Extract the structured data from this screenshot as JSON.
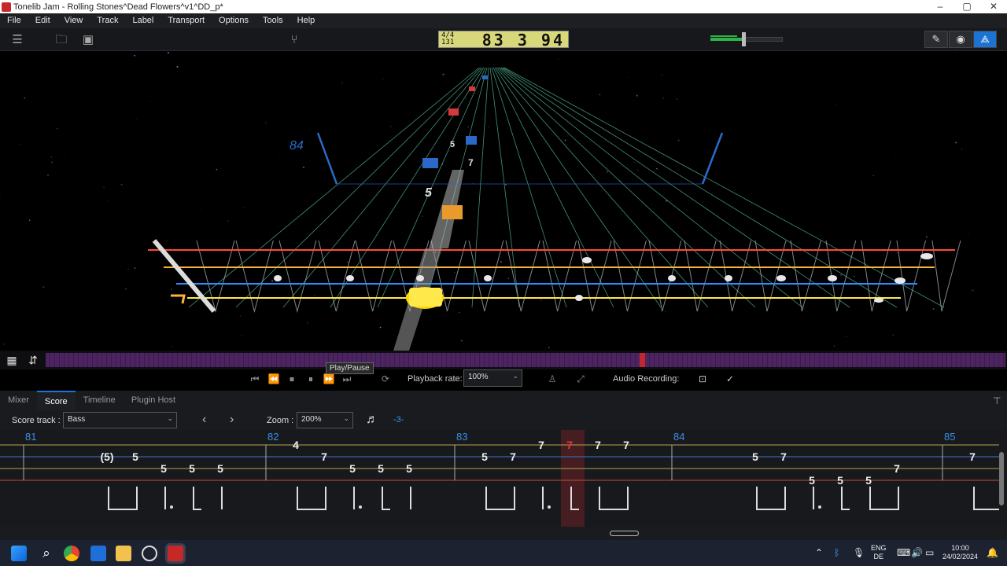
{
  "window": {
    "title": "Tonelib Jam - Rolling Stones^Dead Flowers^v1^DD_p*"
  },
  "menu": [
    "File",
    "Edit",
    "View",
    "Track",
    "Label",
    "Transport",
    "Options",
    "Tools",
    "Help"
  ],
  "counter": {
    "time_sig": "4/4",
    "bar_count": "131",
    "position": "83 3 94"
  },
  "view_buttons": [
    "pencil-icon",
    "eye-icon",
    "strings-icon"
  ],
  "stage": {
    "bar_label": "84",
    "incoming_notes": [
      "5",
      "7",
      "5"
    ],
    "colors": {
      "red_string": "#ff4a3a",
      "orange_string": "#ffb13a",
      "blue_string": "#2f8bff",
      "yellow_string": "#ffe84a",
      "fret_line": "#5fd1a8"
    }
  },
  "tooltip": "Play/Pause",
  "transport": {
    "playback_rate_label": "Playback rate:",
    "playback_rate_value": "100%",
    "audio_recording_label": "Audio Recording:"
  },
  "tabs": [
    "Mixer",
    "Score",
    "Timeline",
    "Plugin Host"
  ],
  "score": {
    "track_label": "Score track :",
    "track_value": "Bass",
    "zoom_label": "Zoom :",
    "zoom_value": "200%",
    "triplet_label": "-3-",
    "bars": [
      "81",
      "82",
      "83",
      "84",
      "85"
    ],
    "notes": [
      {
        "text": "(5)",
        "bar": 81
      },
      {
        "text": "5"
      },
      {
        "text": "5"
      },
      {
        "text": "5"
      },
      {
        "text": "5"
      },
      {
        "text": "4"
      },
      {
        "text": "7"
      },
      {
        "text": "5"
      },
      {
        "text": "5"
      },
      {
        "text": "5"
      },
      {
        "text": "5"
      },
      {
        "text": "7"
      },
      {
        "text": "7"
      },
      {
        "text": "7",
        "active": true
      },
      {
        "text": "7"
      },
      {
        "text": "7"
      },
      {
        "text": "5"
      },
      {
        "text": "7"
      },
      {
        "text": "5"
      },
      {
        "text": "5"
      },
      {
        "text": "5"
      },
      {
        "text": "7"
      },
      {
        "text": "7"
      }
    ]
  },
  "taskbar": {
    "lang_top": "ENG",
    "lang_bottom": "DE",
    "time": "10:00",
    "date": "24/02/2024"
  }
}
